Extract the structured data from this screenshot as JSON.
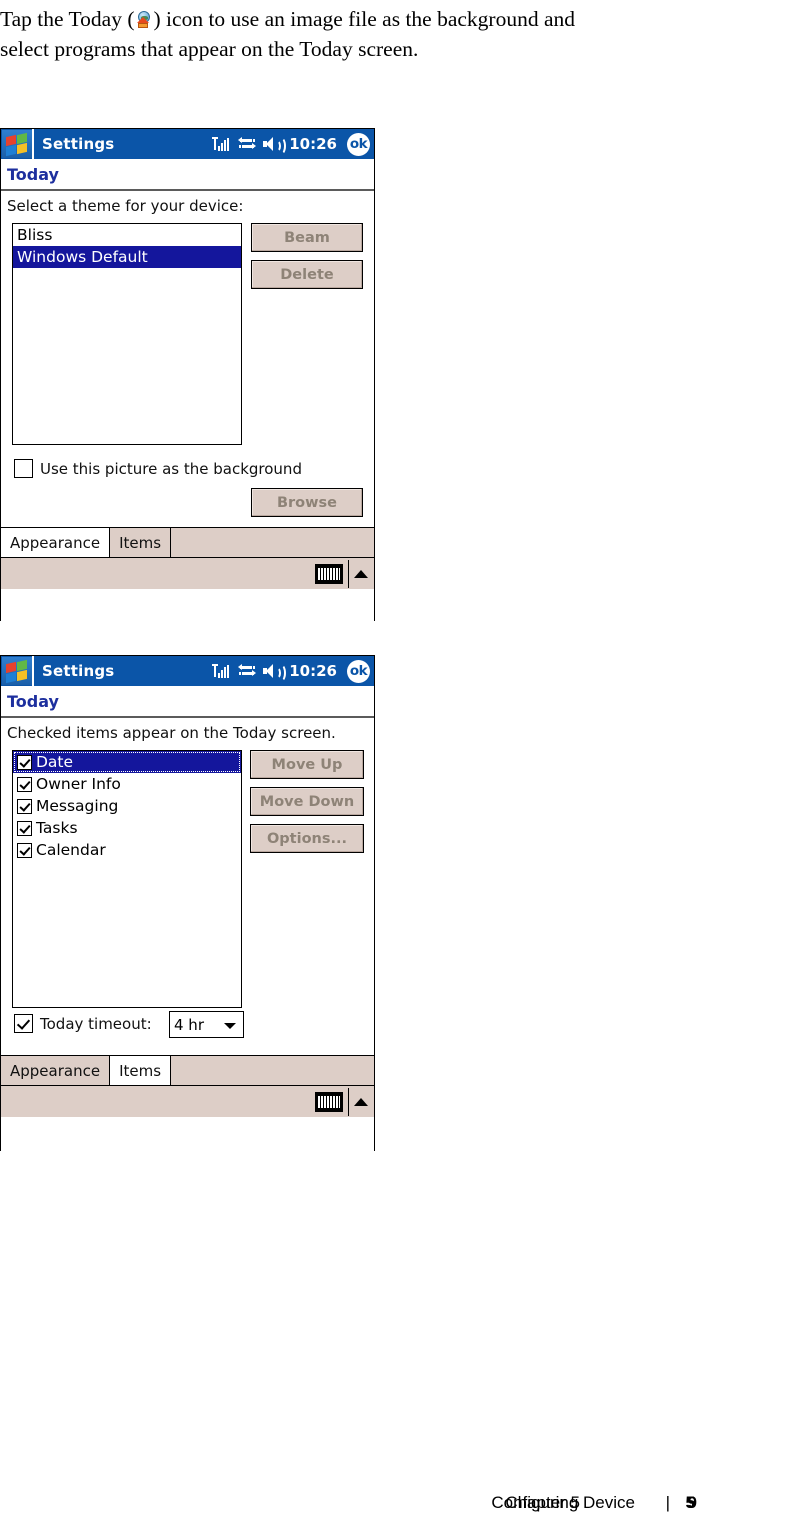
{
  "intro": {
    "line1_a": "Tap the Today (",
    "icon": "today-icon",
    "line1_b": ") icon to use an image file as the background and",
    "line2": "select programs that appear on the Today screen."
  },
  "screens": [
    {
      "id": "appearance",
      "titlebar": {
        "logo": "windows-logo-icon",
        "title": "Settings",
        "signal_icon": "signal-strength-icon",
        "connection_icon": "connectivity-icon",
        "speaker_icon": "speaker-icon",
        "time": "10:26",
        "ok_label": "ok"
      },
      "page_title": "Today",
      "prompt": "Select a theme for your device:",
      "list": [
        {
          "label": "Bliss",
          "selected": false
        },
        {
          "label": "Windows Default",
          "selected": true
        }
      ],
      "buttons": [
        {
          "label": "Beam",
          "disabled": true
        },
        {
          "label": "Delete",
          "disabled": true
        }
      ],
      "checkbox": {
        "label": "Use this picture as the background",
        "checked": false
      },
      "browse_button": {
        "label": "Browse",
        "disabled": true
      },
      "tabs": [
        {
          "label": "Appearance",
          "active": true
        },
        {
          "label": "Items",
          "active": false
        }
      ],
      "cmdbar": {
        "keyboard_icon": "keyboard-icon",
        "up_arrow_icon": "chevron-up-icon"
      }
    },
    {
      "id": "items",
      "titlebar": {
        "logo": "windows-logo-icon",
        "title": "Settings",
        "signal_icon": "signal-strength-icon",
        "connection_icon": "connectivity-icon",
        "speaker_icon": "speaker-icon",
        "time": "10:26",
        "ok_label": "ok"
      },
      "page_title": "Today",
      "prompt": "Checked items appear on the Today screen.",
      "list": [
        {
          "label": "Date",
          "checked": true,
          "selected": true
        },
        {
          "label": "Owner Info",
          "checked": true,
          "selected": false
        },
        {
          "label": "Messaging",
          "checked": true,
          "selected": false
        },
        {
          "label": "Tasks",
          "checked": true,
          "selected": false
        },
        {
          "label": "Calendar",
          "checked": true,
          "selected": false
        }
      ],
      "buttons": [
        {
          "label": "Move Up",
          "disabled": true
        },
        {
          "label": "Move Down",
          "disabled": true
        },
        {
          "label": "Options...",
          "disabled": true
        }
      ],
      "timeout": {
        "label": "Today timeout:",
        "checked": true,
        "value": "4 hr"
      },
      "tabs": [
        {
          "label": "Appearance",
          "active": false
        },
        {
          "label": "Items",
          "active": true
        }
      ],
      "cmdbar": {
        "keyboard_icon": "keyboard-icon",
        "up_arrow_icon": "chevron-up-icon"
      }
    }
  ],
  "footer": {
    "chapter": "Chapter 5",
    "section": "Configuring Device",
    "separator": "|",
    "page_a": "5",
    "page_b": "9"
  },
  "colors": {
    "titlebar_blue": "#0b55a8",
    "heading_blue": "#1d2f9e",
    "selection_blue": "#14169c",
    "chrome_beige": "#ddcec7",
    "disabled_text": "#8e8377"
  }
}
